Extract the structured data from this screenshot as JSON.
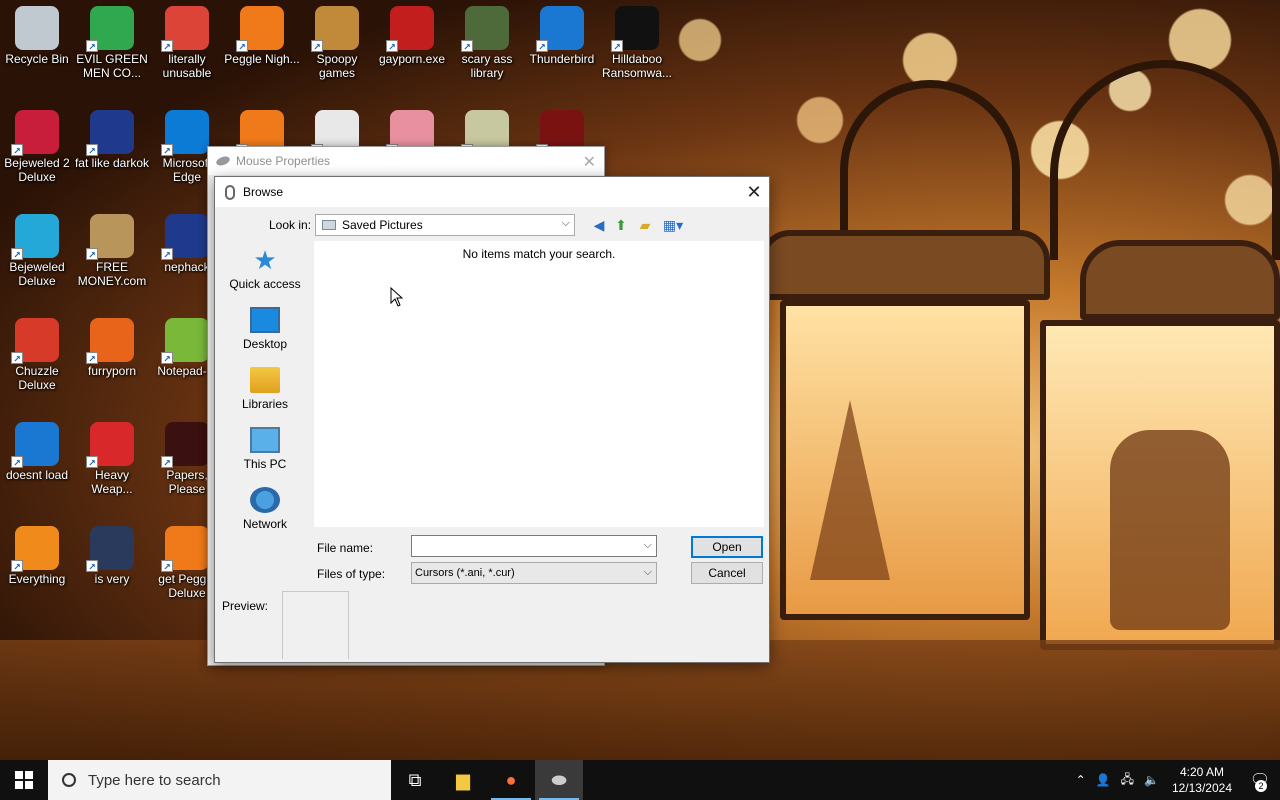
{
  "desktop_icons": [
    {
      "label": "Recycle Bin",
      "icon": "recycle-bin-icon",
      "color": "#c0c8d0"
    },
    {
      "label": "EVIL GREEN MEN CO...",
      "icon": "green-men-icon",
      "color": "#2fa84f"
    },
    {
      "label": "literally unusable",
      "icon": "chrome-icon",
      "color": "#db4437"
    },
    {
      "label": "Peggle Nigh...",
      "icon": "peggle-icon",
      "color": "#f07a1a"
    },
    {
      "label": "Spoopy games",
      "icon": "folder-icon",
      "color": "#c08a3a"
    },
    {
      "label": "gayporn.exe",
      "icon": "flash-icon",
      "color": "#c21e1e"
    },
    {
      "label": "scary ass library",
      "icon": "library-icon",
      "color": "#4f6a3a"
    },
    {
      "label": "Thunderbird",
      "icon": "thunderbird-icon",
      "color": "#1a78d2"
    },
    {
      "label": "Hilldaboo Ransomwa...",
      "icon": "yashma-icon",
      "color": "#111111"
    },
    {
      "label": "Bejeweled 2 Deluxe",
      "icon": "bejeweled2-icon",
      "color": "#c81e3c"
    },
    {
      "label": "fat like darkok",
      "icon": "mpl-icon",
      "color": "#1f3a8c"
    },
    {
      "label": "Microsoft Edge",
      "icon": "edge-icon",
      "color": "#0c7bd6"
    },
    {
      "label": "",
      "icon": "peggle-icon",
      "color": "#f07a1a"
    },
    {
      "label": "",
      "icon": "text-file-icon",
      "color": "#e8e8e8"
    },
    {
      "label": "",
      "icon": "anime-icon",
      "color": "#e890a0"
    },
    {
      "label": "",
      "icon": "pixel-icon",
      "color": "#c8c8a0"
    },
    {
      "label": "",
      "icon": "flash-icon",
      "color": "#7a1212"
    },
    {
      "label": "Bejeweled Deluxe",
      "icon": "bejeweled-icon",
      "color": "#24a8d8"
    },
    {
      "label": "FREE MONEY.com",
      "icon": "money-bag-icon",
      "color": "#b8955a"
    },
    {
      "label": "nephack",
      "icon": "mpl-icon",
      "color": "#1f3a8c"
    },
    {
      "label": "Chuzzle Deluxe",
      "icon": "chuzzle-icon",
      "color": "#d83a2a"
    },
    {
      "label": "furryporn",
      "icon": "firefox-icon",
      "color": "#e8641a"
    },
    {
      "label": "Notepad-...",
      "icon": "notepadpp-icon",
      "color": "#7ab83a"
    },
    {
      "label": "doesnt load",
      "icon": "thunderbird-icon",
      "color": "#1a78d2"
    },
    {
      "label": "Heavy Weap...",
      "icon": "radiation-icon",
      "color": "#d8282a"
    },
    {
      "label": "Papers, Please",
      "icon": "papers-please-icon",
      "color": "#3a1010"
    },
    {
      "label": "Everything",
      "icon": "everything-search-icon",
      "color": "#f08a1a"
    },
    {
      "label": "is very",
      "icon": "mpl-shield-icon",
      "color": "#2a3a5c"
    },
    {
      "label": "get Peggle Deluxe",
      "icon": "peggle-icon",
      "color": "#f07a1a"
    }
  ],
  "mouse_properties": {
    "title": "Mouse Properties"
  },
  "browse": {
    "title": "Browse",
    "look_in_label": "Look in:",
    "look_in_value": "Saved Pictures",
    "empty_message": "No items match your search.",
    "places": [
      {
        "label": "Quick access",
        "icon": "quick-access-star-icon"
      },
      {
        "label": "Desktop",
        "icon": "desktop-icon"
      },
      {
        "label": "Libraries",
        "icon": "libraries-icon"
      },
      {
        "label": "This PC",
        "icon": "this-pc-icon"
      },
      {
        "label": "Network",
        "icon": "network-icon"
      }
    ],
    "file_name_label": "File name:",
    "file_name_value": "",
    "files_of_type_label": "Files of type:",
    "files_of_type_value": "Cursors (*.ani, *.cur)",
    "open_label": "Open",
    "cancel_label": "Cancel",
    "preview_label": "Preview:"
  },
  "taskbar": {
    "search_placeholder": "Type here to search",
    "time": "4:20 AM",
    "date": "12/13/2024",
    "notification_count": "2"
  }
}
